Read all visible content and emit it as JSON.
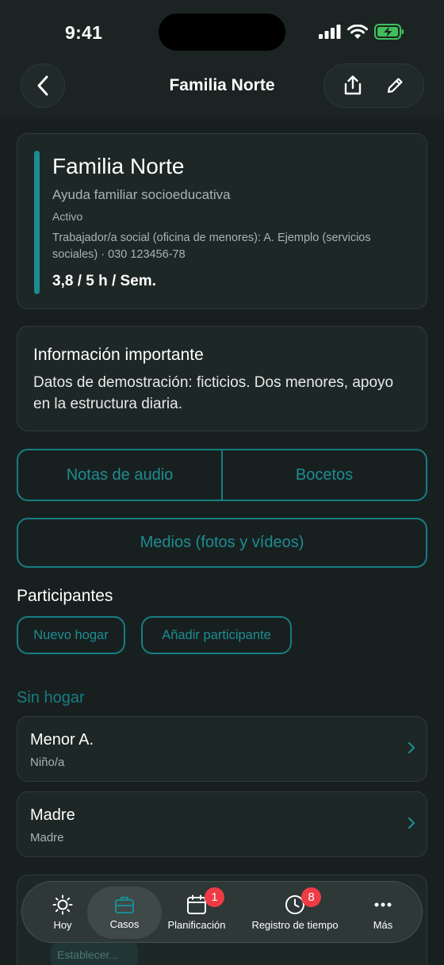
{
  "status_bar": {
    "time": "9:41"
  },
  "nav": {
    "title": "Familia Norte"
  },
  "case": {
    "name": "Familia Norte",
    "type": "Ayuda familiar socioeducativa",
    "status": "Activo",
    "worker": "Trabajador/a social (oficina de menores): A. Ejemplo (servicios sociales) · 030 123456-78",
    "hours": "3,8 / 5 h / Sem."
  },
  "info": {
    "title": "Información importante",
    "body": "Datos de demostración: ficticios. Dos menores, apoyo en la estructura diaria."
  },
  "actions": {
    "audio_notes": "Notas de audio",
    "sketches": "Bocetos",
    "media": "Medios (fotos y vídeos)"
  },
  "participants": {
    "title": "Participantes",
    "new_household": "Nuevo hogar",
    "add_participant": "Añadir participante",
    "group_title": "Sin hogar",
    "items": [
      {
        "name": "Menor A.",
        "role": "Niño/a"
      },
      {
        "name": "Madre",
        "role": "Madre"
      }
    ]
  },
  "peek": {
    "chip": "Establecer..."
  },
  "tabbar": {
    "tabs": [
      {
        "label": "Hoy"
      },
      {
        "label": "Casos"
      },
      {
        "label": "Planificación",
        "badge": "1"
      },
      {
        "label": "Registro de tiempo",
        "badge": "8"
      },
      {
        "label": "Más"
      }
    ],
    "active": "Casos"
  },
  "colors": {
    "accent": "#1a8c92",
    "background": "#18201f",
    "card": "#1d2726",
    "badge": "#ef3b45"
  }
}
